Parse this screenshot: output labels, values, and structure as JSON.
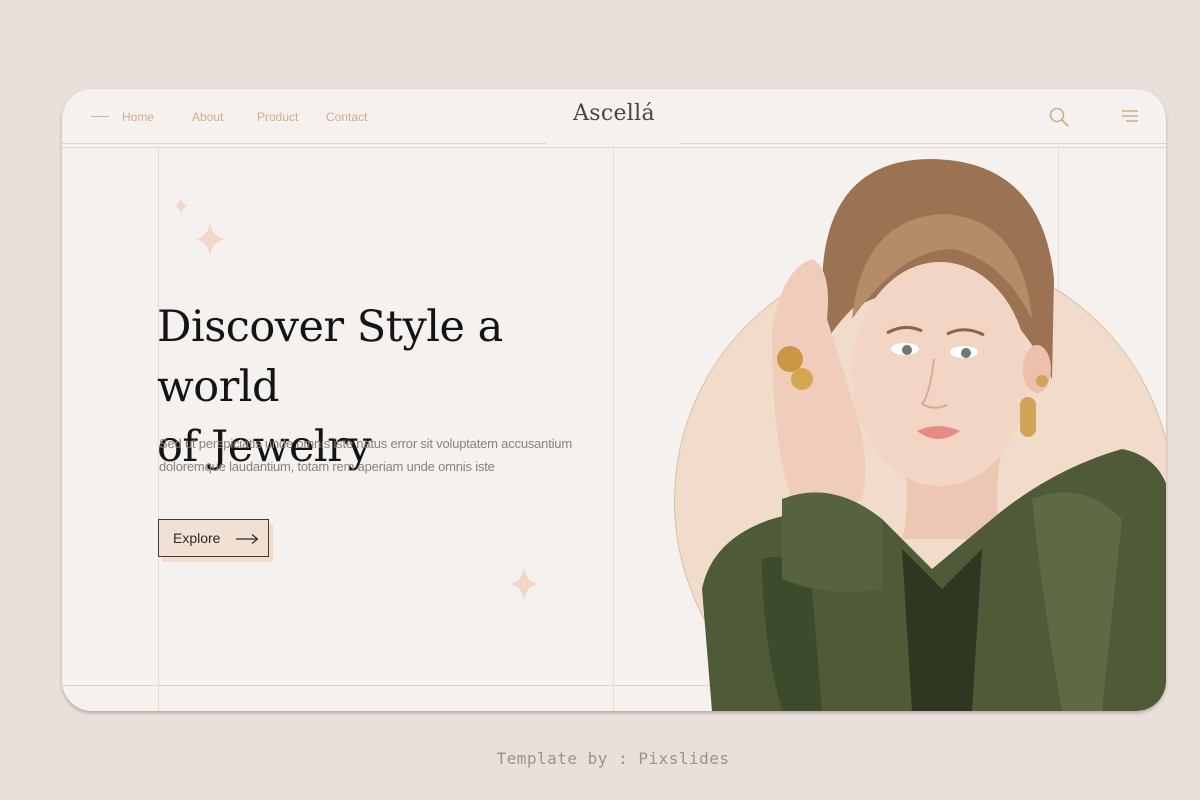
{
  "nav": {
    "links": [
      "Home",
      "About",
      "Product",
      "Contact"
    ],
    "logo": "Ascellá",
    "icons": {
      "search": "search-icon",
      "menu": "hamburger-menu-icon"
    }
  },
  "hero": {
    "headline_line1": "Discover Style a world",
    "headline_line2": "of Jewelry",
    "body_line1": "Sed ut perspiciatis unde omnis iste natus error sit voluptatem accusantium",
    "body_line2": "doloremque laudantium, totam rem aperiam unde omnis iste",
    "explore_label": "Explore",
    "image_alt": "model-wearing-gold-jewelry"
  },
  "credit": "Template by : Pixslides",
  "colors": {
    "background": "#e9e0db",
    "card": "#f5f1ee",
    "accent": "#cfae8a",
    "circle": "#f1dccb",
    "blouse": "#4e5a38"
  }
}
